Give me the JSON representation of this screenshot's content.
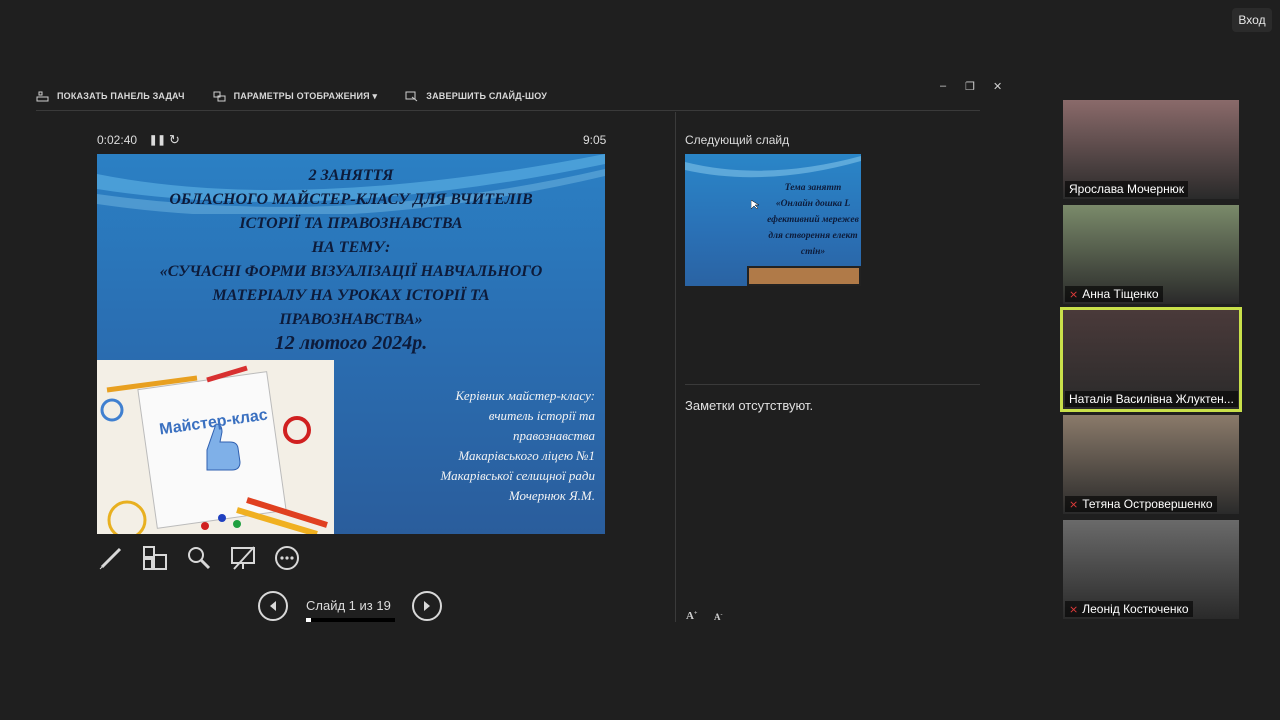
{
  "header": {
    "login_label": "Вход"
  },
  "toolbar": {
    "show_taskbar": "ПОКАЗАТЬ ПАНЕЛЬ ЗАДАЧ",
    "display_settings": "ПАРАМЕТРЫ ОТОБРАЖЕНИЯ ▾",
    "end_slideshow": "ЗАВЕРШИТЬ СЛАЙД-ШОУ",
    "minimize_glyph": "–",
    "restore_glyph": "❐",
    "close_glyph": "✕"
  },
  "presenter": {
    "elapsed": "0:02:40",
    "clock": "9:05",
    "pause_glyph": "❚❚",
    "reset_glyph": "↻",
    "slide_counter": "Слайд 1 из 19",
    "progress": 0.0526,
    "next_slide_label": "Следующий слайд",
    "notes_text": "Заметки отсутствуют.",
    "font_up": "A",
    "font_down": "A"
  },
  "current_slide": {
    "title": "2 ЗАНЯТТЯ\nОБЛАСНОГО МАЙСТЕР-КЛАСУ ДЛЯ ВЧИТЕЛІВ\nІСТОРІЇ ТА ПРАВОЗНАВСТВА\nНА ТЕМУ:\n«СУЧАСНІ ФОРМИ ВІЗУАЛІЗАЦІЇ НАВЧАЛЬНОГО\nМАТЕРІАЛУ НА УРОКАХ ІСТОРІЇ ТА\nПРАВОЗНАВСТВА»",
    "date": "12 лютого 2024р.",
    "image_text": "Майстер-клас",
    "author": "Керівник майстер-класу:\nвчитель історії та\nправознавства\nМакарівського ліцею №1\nМакарівської селищної ради\nМочернюк Я.М."
  },
  "next_slide": {
    "text": "Тема занятт\n«Онлайн дошка L\nефективний мережев\nдля створення елект\nстін»"
  },
  "participants": [
    {
      "name": "Ярослава Мочернюк",
      "muted": false,
      "active": false,
      "bg": "#8a6a6a"
    },
    {
      "name": "Анна Тіщенко",
      "muted": true,
      "active": false,
      "bg": "#7a8a6a"
    },
    {
      "name": "Наталія Василівна Жлуктен...",
      "muted": false,
      "active": true,
      "bg": "#4a3a3a"
    },
    {
      "name": "Тетяна Островершенко",
      "muted": true,
      "active": false,
      "bg": "#8a7a6a"
    },
    {
      "name": "Леонід Костюченко",
      "muted": true,
      "active": false,
      "bg": "#6a6a6a"
    }
  ]
}
